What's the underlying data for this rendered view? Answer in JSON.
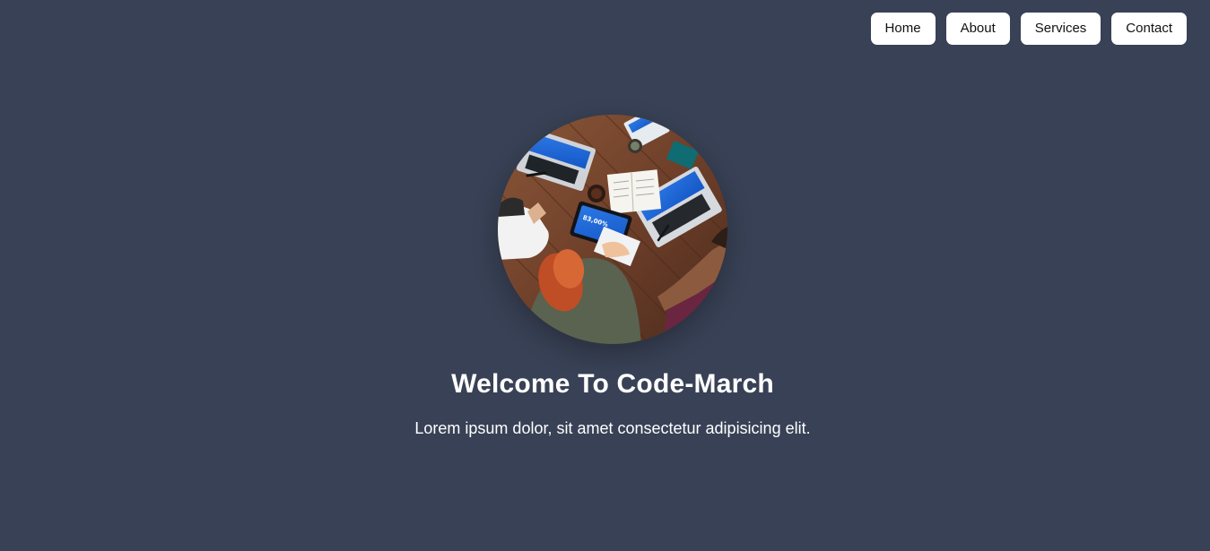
{
  "nav": {
    "items": [
      {
        "label": "Home"
      },
      {
        "label": "About"
      },
      {
        "label": "Services"
      },
      {
        "label": "Contact"
      }
    ]
  },
  "hero": {
    "title": "Welcome To Code-March",
    "subtitle": "Lorem ipsum dolor, sit amet consectetur adipisicing elit.",
    "image": {
      "tablet_screen_text": "83,00%"
    }
  },
  "colors": {
    "background": "#384155",
    "nav_button_bg": "#ffffff",
    "nav_button_text": "#111111",
    "text": "#ffffff"
  },
  "icons": {
    "hero_image": "team-meeting-photo"
  }
}
